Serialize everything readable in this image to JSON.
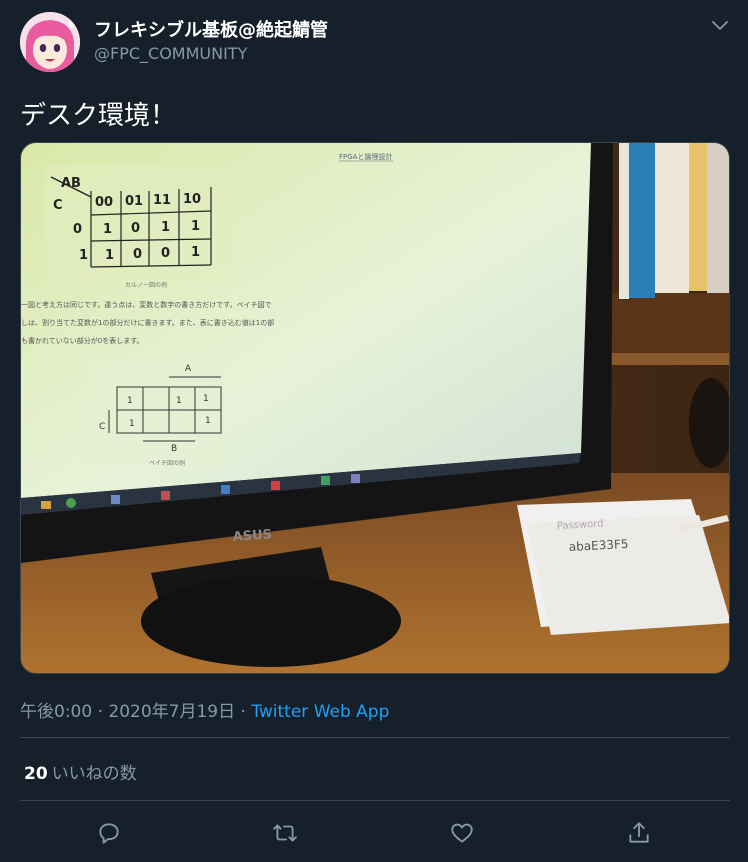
{
  "user": {
    "display_name": "フレキシブル基板@絶起鯖管",
    "handle": "@FPC_COMMUNITY"
  },
  "tweet": {
    "text": "デスク環境！"
  },
  "photo": {
    "screen_header": "FPGAと論理設計",
    "kmap_ab": "AB",
    "kmap_c": "C",
    "kmap_cols": [
      "00",
      "01",
      "11",
      "10"
    ],
    "kmap_rows": [
      {
        "label": "0",
        "cells": [
          "1",
          "0",
          "1",
          "1"
        ]
      },
      {
        "label": "1",
        "cells": [
          "1",
          "0",
          "0",
          "1"
        ]
      }
    ],
    "kmap_caption": "カルノー図の例",
    "para_lines": [
      "一図と考え方は同じです。違う点は、変数と数字の書き方だけです。ベイチ図で",
      "しは、割り当てた変数が1の部分だけに書きます。また、表に書き込む値は1の部",
      "も書かれていない部分が0を表します。"
    ],
    "veitch_a": "A",
    "veitch_b": "B",
    "veitch_c": "C",
    "veitch_caption": "ベイチ図の例",
    "monitor_brand": "ASUS",
    "note_line1": "Password",
    "note_line2": "abaE33F5"
  },
  "meta": {
    "time_date": "午後0:00 · 2020年7月19日 · ",
    "via": "Twitter Web App"
  },
  "stats": {
    "likes_count": "20",
    "likes_label": "いいねの数"
  },
  "icons": {
    "more": "chevron-down-icon",
    "reply": "reply-icon",
    "retweet": "retweet-icon",
    "like": "heart-icon",
    "share": "share-icon"
  },
  "colors": {
    "background": "#15202b",
    "secondary_text": "#8899a6",
    "link": "#1da1f2",
    "divider": "#38444d"
  }
}
